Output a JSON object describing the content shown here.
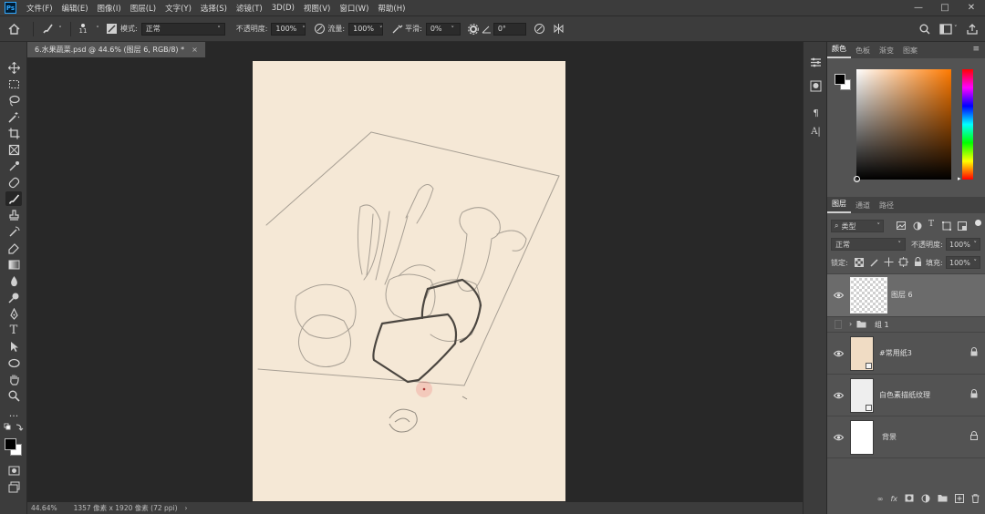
{
  "menubar": {
    "logo": "Ps",
    "items": [
      "文件(F)",
      "编辑(E)",
      "图像(I)",
      "图层(L)",
      "文字(Y)",
      "选择(S)",
      "滤镜(T)",
      "3D(D)",
      "视图(V)",
      "窗口(W)",
      "帮助(H)"
    ]
  },
  "options": {
    "brush_size": "11",
    "mode_label": "模式:",
    "mode_value": "正常",
    "opacity_label": "不透明度:",
    "opacity_value": "100%",
    "flow_label": "流量:",
    "flow_value": "100%",
    "smooth_label": "平滑:",
    "smooth_value": "0%",
    "angle_value": "0°"
  },
  "document": {
    "tab_title": "6.水果蔬菜.psd @ 44.6% (图层 6, RGB/8) *",
    "zoom": "44.64%",
    "dimensions": "1357 像素 x 1920 像素 (72 ppi)"
  },
  "color_panel": {
    "tabs": [
      "颜色",
      "色板",
      "渐变",
      "图案"
    ],
    "foreground": "#000000",
    "background": "#ffffff"
  },
  "layers_panel": {
    "tabs": [
      "图层",
      "通道",
      "路径"
    ],
    "filter_kind": "类型",
    "blend_mode": "正常",
    "opacity_label": "不透明度:",
    "opacity_value": "100%",
    "lock_label": "锁定:",
    "fill_label": "填充:",
    "fill_value": "100%",
    "layers": [
      {
        "name": "图层 6",
        "visible": true,
        "selected": true,
        "locked": false
      },
      {
        "name": "组 1",
        "visible": false,
        "selected": false,
        "locked": false
      },
      {
        "name": "#常用纸3",
        "visible": true,
        "selected": false,
        "locked": true
      },
      {
        "name": "白色素描纸纹理",
        "visible": true,
        "selected": false,
        "locked": true
      },
      {
        "name": "背景",
        "visible": true,
        "selected": false,
        "locked": true
      }
    ]
  },
  "colors": {
    "paper": "#f5e8d6",
    "app_bg": "#535353",
    "accent": "#31a8ff"
  }
}
